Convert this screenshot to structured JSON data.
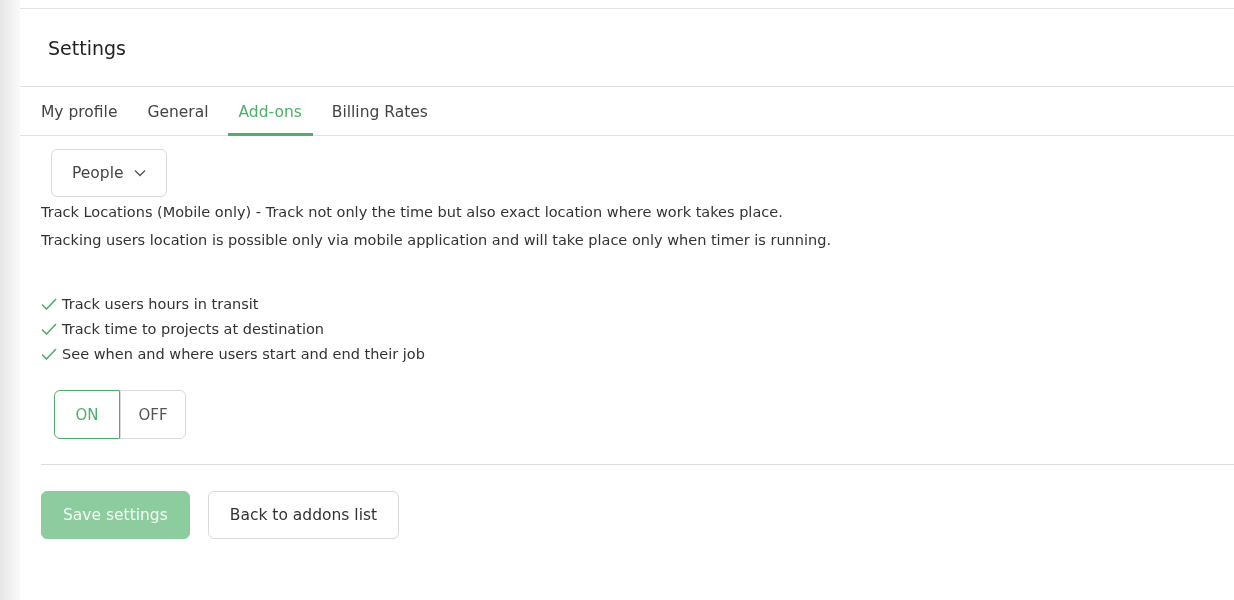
{
  "title": "Settings",
  "tabs": [
    {
      "label": "My profile",
      "selected": false
    },
    {
      "label": "General",
      "selected": false
    },
    {
      "label": "Add-ons",
      "selected": true
    },
    {
      "label": "Billing Rates",
      "selected": false
    }
  ],
  "dropdown": {
    "value": "People"
  },
  "description": [
    "Track Locations (Mobile only) - Track not only the time but also exact location where work takes place.",
    "Tracking users location is possible only via mobile application and will take place only when timer is running."
  ],
  "features": [
    {
      "label": "Track users hours in transit",
      "checked": true
    },
    {
      "label": "Track time to projects at destination",
      "checked": true
    },
    {
      "label": "See when and where users start and end their job",
      "checked": true
    }
  ],
  "toggle": [
    {
      "label": "ON",
      "selected": true
    },
    {
      "label": "OFF",
      "selected": false
    }
  ],
  "buttons": [
    {
      "label": "Save settings",
      "kind": "primary",
      "disabled": true
    },
    {
      "label": "Back to addons list",
      "kind": "secondary",
      "disabled": false
    }
  ]
}
